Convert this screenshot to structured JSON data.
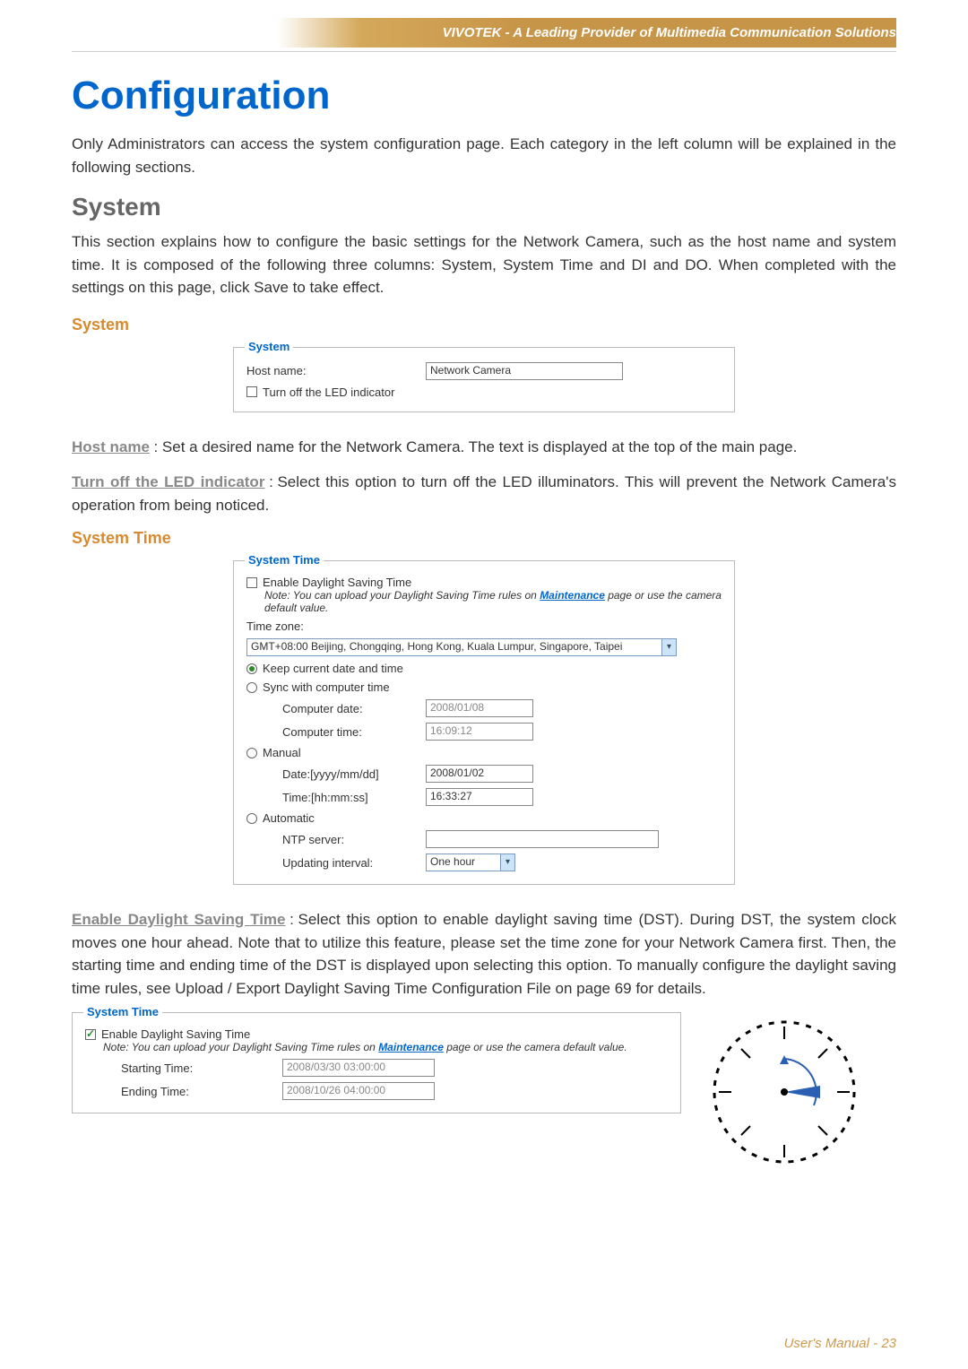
{
  "header": {
    "tagline": "VIVOTEK - A Leading Provider of Multimedia Communication Solutions"
  },
  "title": "Configuration",
  "intro": "Only Administrators can access the system configuration page. Each category in the left column will be explained in the following sections.",
  "system": {
    "heading": "System",
    "body": "This section explains how to configure the basic settings for the Network Camera, such as the host name and system time. It is composed of the following three columns: System, System Time and DI and DO. When completed with the settings on this page, click Save to take effect.",
    "sub_heading": "System",
    "fieldset": {
      "legend": "System",
      "host_name_label": "Host name:",
      "host_name_value": "Network Camera",
      "led_label": "Turn off the LED indicator"
    },
    "host_name_term": "Host name",
    "host_name_text": "Set a desired name for the Network Camera. The text is displayed at the top of the main page.",
    "led_term": "Turn off the LED indicator",
    "led_text": "Select this option to turn off the LED illuminators. This will prevent the Network Camera's operation from being noticed."
  },
  "system_time": {
    "sub_heading": "System Time",
    "fieldset": {
      "legend": "System Time",
      "enable_dst_label": "Enable Daylight Saving Time",
      "note_prefix": "Note: You can upload your Daylight Saving Time rules on ",
      "maintenance_link": "Maintenance",
      "note_suffix": " page or use the camera default value.",
      "timezone_label": "Time zone:",
      "timezone_value": "GMT+08:00 Beijing, Chongqing, Hong Kong, Kuala Lumpur, Singapore, Taipei",
      "keep_label": "Keep current date and time",
      "sync_label": "Sync with computer time",
      "computer_date_label": "Computer date:",
      "computer_date_value": "2008/01/08",
      "computer_time_label": "Computer time:",
      "computer_time_value": "16:09:12",
      "manual_label": "Manual",
      "manual_date_label": "Date:[yyyy/mm/dd]",
      "manual_date_value": "2008/01/02",
      "manual_time_label": "Time:[hh:mm:ss]",
      "manual_time_value": "16:33:27",
      "automatic_label": "Automatic",
      "ntp_label": "NTP server:",
      "ntp_value": "",
      "interval_label": "Updating interval:",
      "interval_value": "One hour"
    },
    "dst_term": "Enable Daylight Saving Time",
    "dst_text": "Select this option to enable daylight saving time (DST). During DST, the system clock moves one hour ahead. Note that to utilize this feature, please set the time zone for your Network Camera first. Then, the starting time and ending time of the DST is displayed upon selecting this option. To manually configure the daylight saving time rules, see Upload / Export Daylight Saving Time Configuration File on page 69 for details.",
    "dst_fieldset": {
      "legend": "System Time",
      "enable_dst_label": "Enable Daylight Saving Time",
      "note_prefix": "Note: You can upload your Daylight Saving Time rules on ",
      "maintenance_link": "Maintenance",
      "note_suffix": " page or use the camera default value.",
      "starting_label": "Starting Time:",
      "starting_value": "2008/03/30 03:00:00",
      "ending_label": "Ending Time:",
      "ending_value": "2008/10/26 04:00:00"
    }
  },
  "footer": {
    "text": "User's Manual - ",
    "page": "23"
  }
}
